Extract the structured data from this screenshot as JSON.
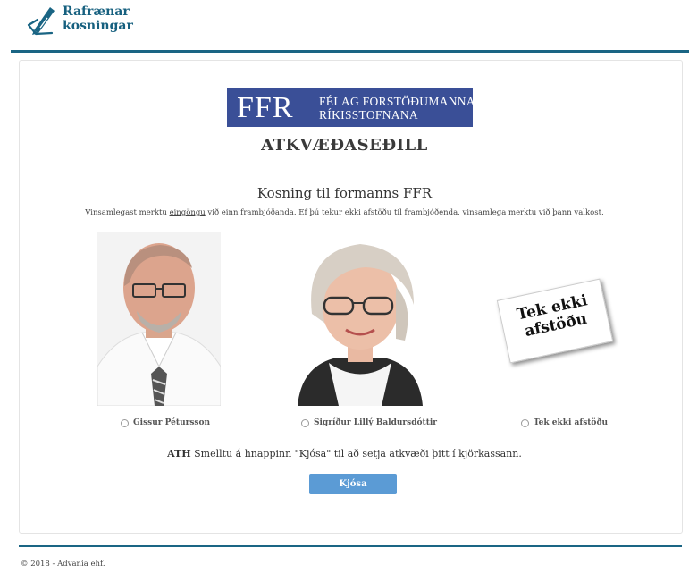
{
  "header": {
    "logo_icon": "ballot-pen-icon",
    "logo_line1": "Rafrænar",
    "logo_line2": "kosningar",
    "accent_color": "#1a6584"
  },
  "org_banner": {
    "letters": "FFR",
    "line1": "FÉLAG FORSTÖÐUMANNA",
    "line2": "RÍKISSTOFNANA",
    "color": "#3a4f97"
  },
  "ballot_title": "ATKVÆÐASEÐILL",
  "election": {
    "title": "Kosning til formanns FFR",
    "instructions_before": "Vinsamlegast merktu ",
    "instructions_underlined": "eingöngu",
    "instructions_after": " við einn frambjóðanda. Ef þú tekur ekki afstöðu til frambjóðenda, vinsamlega merktu við þann valkost."
  },
  "options": [
    {
      "label": "Gissur Pétursson",
      "selected": false
    },
    {
      "label": "Sigríður Lillý Baldursdóttir",
      "selected": false
    },
    {
      "label": "Tek ekki afstöðu",
      "selected": false
    }
  ],
  "abstain_card": {
    "line1": "Tek ekki",
    "line2": "afstöðu"
  },
  "note": {
    "bold": "ATH",
    "text": " Smelltu á hnappinn \"Kjósa\" til að setja atkvæði þitt í kjörkassann."
  },
  "vote_button": {
    "label": "Kjósa",
    "color": "#5b9bd5"
  },
  "footer": {
    "text": "© 2018 - Advania ehf."
  }
}
